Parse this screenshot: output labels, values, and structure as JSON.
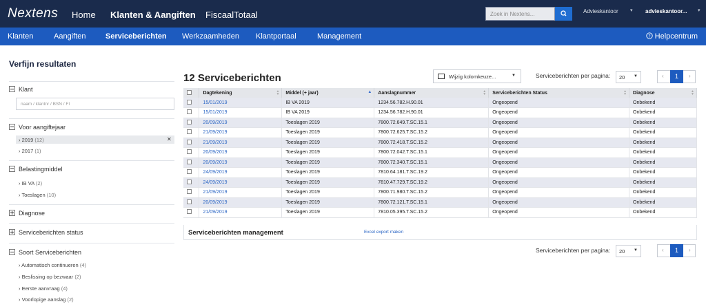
{
  "topbar": {
    "logo": "Nextens",
    "nav": [
      "Home",
      "Klanten & Aangiften",
      "FiscaalTotaal"
    ],
    "search_placeholder": "Zoek in Nextens...",
    "office": "Advieskantoor",
    "user": "advieskantoor..."
  },
  "subnav": {
    "items": [
      "Klanten",
      "Aangiften",
      "Serviceberichten",
      "Werkzaamheden",
      "Klantportaal",
      "Management"
    ],
    "help": "Helpcentrum"
  },
  "sidebar": {
    "title": "Verfijn resultaten",
    "klant": {
      "label": "Klant",
      "placeholder": "naam / klantnr / BSN / FI"
    },
    "jaar": {
      "label": "Voor aangiftejaar",
      "items": [
        {
          "label": "2019",
          "count": "(12)"
        },
        {
          "label": "2017",
          "count": "(1)"
        }
      ]
    },
    "middel": {
      "label": "Belastingmiddel",
      "items": [
        {
          "label": "IB VA",
          "count": "(2)"
        },
        {
          "label": "Toeslagen",
          "count": "(10)"
        }
      ]
    },
    "diagnose": {
      "label": "Diagnose"
    },
    "status": {
      "label": "Serviceberichten status"
    },
    "soort": {
      "label": "Soort Serviceberichten",
      "items": [
        {
          "label": "Automatisch continueren",
          "count": "(4)"
        },
        {
          "label": "Beslissing op bezwaar",
          "count": "(2)"
        },
        {
          "label": "Eerste aanvraag",
          "count": "(4)"
        },
        {
          "label": "Voorlopige aanslag",
          "count": "(2)"
        }
      ]
    }
  },
  "main": {
    "title": "12 Serviceberichten",
    "column_select": "Wijzig kolomkeuze...",
    "per_page_label": "Serviceberichten per pagina:",
    "per_page": "20",
    "page": "1",
    "columns": [
      "Dagtekening",
      "Middel (+ jaar)",
      "Aanslagnummer",
      "Serviceberichten Status",
      "Diagnose"
    ],
    "rows": [
      [
        "15/01/2019",
        "IB VA 2019",
        "1234.56.782.H.90.01",
        "Ongeopend",
        "Onbekend"
      ],
      [
        "15/01/2019",
        "IB VA 2019",
        "1234.56.782.H.90.01",
        "Ongeopend",
        "Onbekend"
      ],
      [
        "20/09/2019",
        "Toeslagen 2019",
        "7800.72.649.T.SC.15.1",
        "Ongeopend",
        "Onbekend"
      ],
      [
        "21/09/2019",
        "Toeslagen 2019",
        "7800.72.625.T.SC.15.2",
        "Ongeopend",
        "Onbekend"
      ],
      [
        "21/09/2019",
        "Toeslagen 2019",
        "7800.72.418.T.SC.15.2",
        "Ongeopend",
        "Onbekend"
      ],
      [
        "20/09/2019",
        "Toeslagen 2019",
        "7800.72.042.T.SC.15.1",
        "Ongeopend",
        "Onbekend"
      ],
      [
        "20/09/2019",
        "Toeslagen 2019",
        "7800.72.340.T.SC.15.1",
        "Ongeopend",
        "Onbekend"
      ],
      [
        "24/09/2019",
        "Toeslagen 2019",
        "7810.64.181.T.SC.19.2",
        "Ongeopend",
        "Onbekend"
      ],
      [
        "24/09/2019",
        "Toeslagen 2019",
        "7810.47.729.T.SC.19.2",
        "Ongeopend",
        "Onbekend"
      ],
      [
        "21/09/2019",
        "Toeslagen 2019",
        "7800.71.980.T.SC.15.2",
        "Ongeopend",
        "Onbekend"
      ],
      [
        "20/09/2019",
        "Toeslagen 2019",
        "7800.72.121.T.SC.15.1",
        "Ongeopend",
        "Onbekend"
      ],
      [
        "21/09/2019",
        "Toeslagen 2019",
        "7810.05.395.T.SC.15.2",
        "Ongeopend",
        "Onbekend"
      ]
    ],
    "management_title": "Serviceberichten management",
    "export_link": "Excel export maken"
  }
}
